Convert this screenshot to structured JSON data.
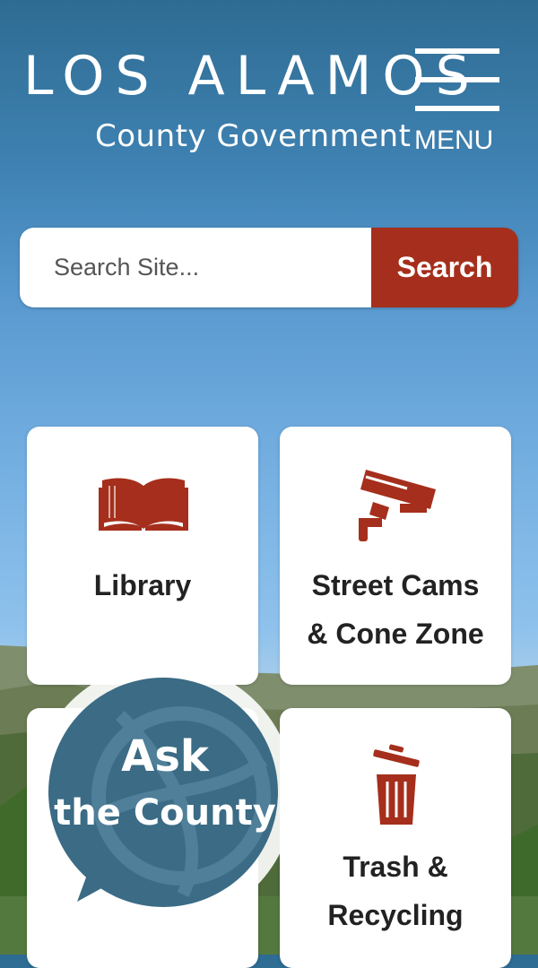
{
  "header": {
    "logo_title": "LOS ALAMOS",
    "logo_subtitle": "County Government",
    "menu_label": "MENU"
  },
  "search": {
    "placeholder": "Search Site...",
    "button_label": "Search"
  },
  "tiles": [
    {
      "label_lines": [
        "Library"
      ],
      "icon": "book-icon"
    },
    {
      "label_lines": [
        "Street Cams",
        "& Cone Zone"
      ],
      "icon": "security-camera-icon"
    },
    {
      "label_lines": [],
      "icon": ""
    },
    {
      "label_lines": [
        "Trash &",
        "Recycling"
      ],
      "icon": "trash-can-icon"
    }
  ],
  "ask_county": {
    "line1": "Ask",
    "line2": "the County"
  },
  "colors": {
    "accent": "#a52f1c",
    "ask_bubble": "#3b6b85",
    "tile_bg": "#ffffff"
  }
}
